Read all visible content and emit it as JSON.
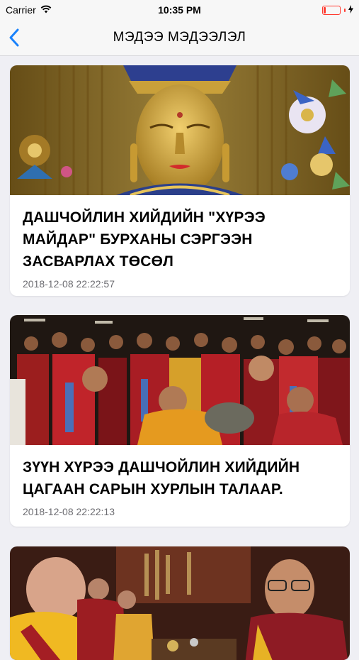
{
  "status_bar": {
    "carrier": "Carrier",
    "time": "10:35 PM",
    "battery_level": 0.12,
    "battery_color": "#ff3b30"
  },
  "nav": {
    "title": "МЭДЭЭ МЭДЭЭЛЭЛ",
    "back_icon": "chevron-left-icon",
    "accent_color": "#1a82fb"
  },
  "news": [
    {
      "title": "ДАШЧОЙЛИН ХИЙДИЙН \"ХҮРЭЭ МАЙДАР\" БУРХАНЫ СЭРГЭЭН ЗАСВАРЛАХ ТӨСӨЛ",
      "date": "2018-12-08 22:22:57"
    },
    {
      "title": "ЗҮҮН ХҮРЭЭ ДАШЧОЙЛИН ХИЙДИЙН ЦАГААН САРЫН ХУРЛЫН ТАЛААР.",
      "date": "2018-12-08 22:22:13"
    },
    {
      "title": "",
      "date": ""
    }
  ]
}
